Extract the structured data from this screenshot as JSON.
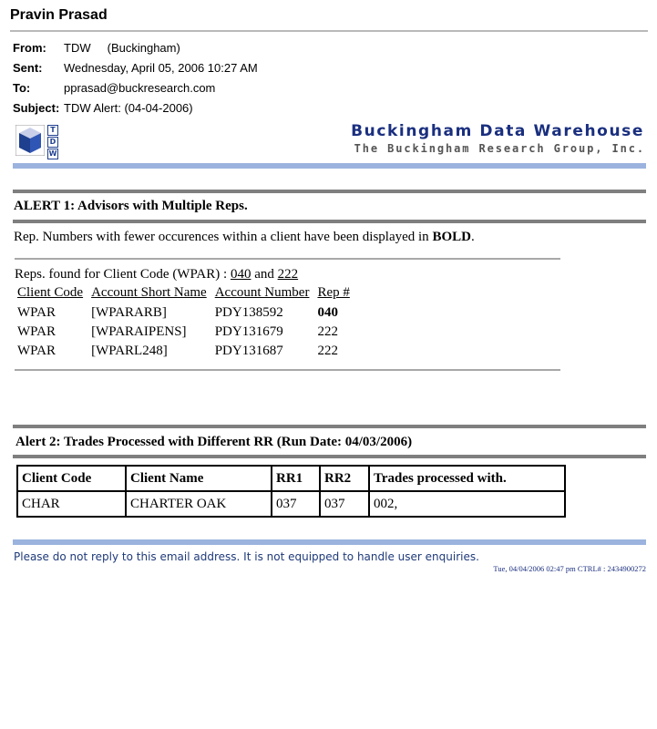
{
  "sender": "Pravin Prasad",
  "header": {
    "from_label": "From:",
    "from_name": "TDW",
    "from_location": "(Buckingham)",
    "sent_label": "Sent:",
    "sent_value": "Wednesday, April 05, 2006 10:27 AM",
    "to_label": "To:",
    "to_value": "pprasad@buckresearch.com",
    "subject_label": "Subject:",
    "subject_value": "TDW Alert: (04-04-2006)"
  },
  "banner": {
    "logo_letters": [
      "T",
      "D",
      "W"
    ],
    "title": "Buckingham Data Warehouse",
    "subtitle": "The Buckingham Research Group, Inc.",
    "accent_color": "#9bb3de",
    "title_color": "#1a2f7f"
  },
  "alert1": {
    "title": "ALERT 1: Advisors with Multiple Reps.",
    "desc_prefix": "Rep. Numbers with fewer occurences within a client have been displayed in ",
    "desc_bold": "BOLD",
    "desc_suffix": ".",
    "reps_prefix": "Reps. found for Client Code (WPAR) : ",
    "rep_a": "040",
    "reps_and": " and ",
    "rep_b": "222",
    "columns": [
      "Client Code",
      "Account Short Name",
      "Account Number",
      "Rep #"
    ],
    "rows": [
      {
        "client": "WPAR",
        "short_name": "[WPARARB]",
        "account": "PDY138592",
        "rep": "040",
        "bold": true
      },
      {
        "client": "WPAR",
        "short_name": "[WPARAIPENS]",
        "account": "PDY131679",
        "rep": "222",
        "bold": false
      },
      {
        "client": "WPAR",
        "short_name": "[WPARL248]",
        "account": "PDY131687",
        "rep": "222",
        "bold": false
      }
    ]
  },
  "alert2": {
    "title": "Alert 2: Trades Processed with Different RR (Run Date: 04/03/2006)",
    "columns": [
      "Client Code",
      "Client Name",
      "RR1",
      "RR2",
      "Trades processed with."
    ],
    "rows": [
      {
        "client_code": "CHAR",
        "client_name": "CHARTER OAK",
        "rr1": "037",
        "rr2": "037",
        "trades": "002,"
      }
    ]
  },
  "footer": {
    "noreply": "Please do not reply to this email address. It is not equipped to handle user enquiries.",
    "timestamp": "Tue, 04/04/2006 02:47 pm CTRL# : 2434900272"
  }
}
